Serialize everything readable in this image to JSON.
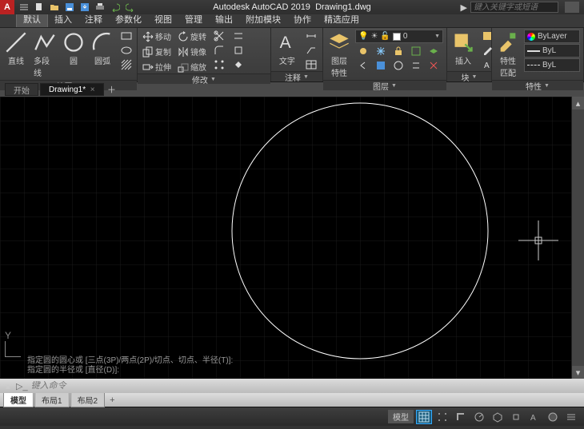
{
  "app": {
    "name": "Autodesk AutoCAD 2019",
    "doc": "Drawing1.dwg",
    "search_placeholder": "键入关键字或短语"
  },
  "ribbon_tabs": [
    "默认",
    "插入",
    "注释",
    "参数化",
    "视图",
    "管理",
    "输出",
    "附加模块",
    "协作",
    "精选应用"
  ],
  "ribbon_active": 0,
  "panels": {
    "draw": {
      "title": "绘图",
      "line": "直线",
      "polyline": "多段线",
      "circle": "圆",
      "arc": "圆弧"
    },
    "modify": {
      "title": "修改",
      "move": "移动",
      "copy": "复制",
      "stretch": "拉伸",
      "rotate": "旋转",
      "mirror": "镜像",
      "scale": "缩放"
    },
    "annot": {
      "title": "注释",
      "text": "文字"
    },
    "layers": {
      "title": "图层",
      "props": "图层\n特性",
      "current": "0"
    },
    "block": {
      "title": "块",
      "insert": "插入"
    },
    "props": {
      "title": "特性",
      "match": "特性\n匹配",
      "bylayer": "ByLayer",
      "byl": "ByL"
    }
  },
  "file_tabs": {
    "start": "开始",
    "doc": "Drawing1*"
  },
  "layout_tabs": [
    "模型",
    "布局1",
    "布局2"
  ],
  "cmd": {
    "hist1": "指定圆的圆心或 [三点(3P)/两点(2P)/切点、切点、半径(T)]:",
    "hist2": "指定圆的半径或 [直径(D)]:",
    "placeholder": "键入命令"
  },
  "status_model": "模型",
  "colors": {
    "accent": "#1a5a7a",
    "canvas": "#000000",
    "circle": "#ffffff"
  }
}
